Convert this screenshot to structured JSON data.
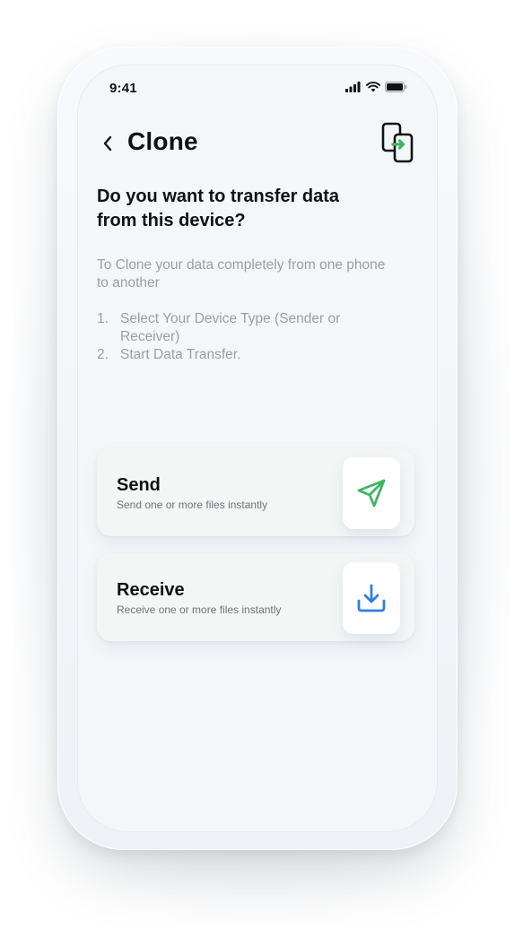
{
  "status_bar": {
    "time": "9:41"
  },
  "header": {
    "title": "Clone",
    "back_glyph": "<"
  },
  "main": {
    "question": "Do you want to transfer data from this device?",
    "description": "To Clone your data completely from one phone to another",
    "steps": [
      {
        "num": "1.",
        "text": "Select Your Device Type (Sender or Receiver)"
      },
      {
        "num": "2.",
        "text": "Start Data Transfer."
      }
    ]
  },
  "options": [
    {
      "title": "Send",
      "subtitle": "Send one or more files instantly",
      "icon": "send-icon"
    },
    {
      "title": "Receive",
      "subtitle": "Receive one or more files instantly",
      "icon": "download-icon"
    }
  ],
  "colors": {
    "send_accent": "#3cb562",
    "receive_accent": "#2f7fe0",
    "text": "#111111",
    "muted": "#9a9ea5"
  }
}
